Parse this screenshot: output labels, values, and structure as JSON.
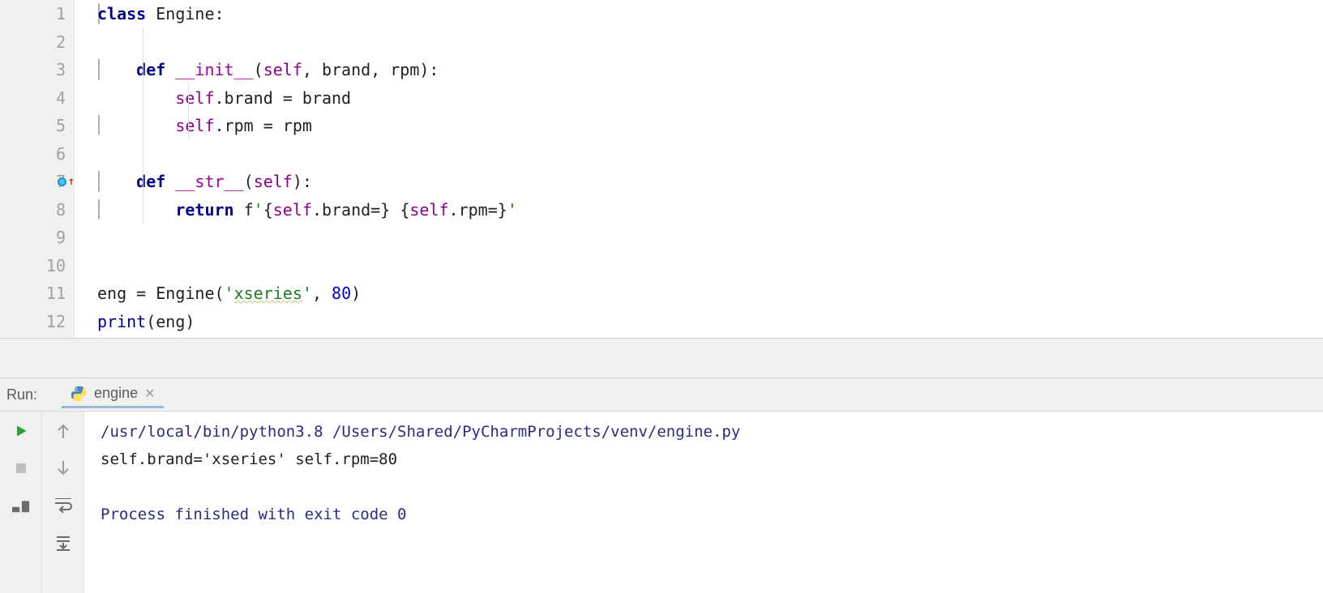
{
  "gutter": {
    "lines": [
      "1",
      "2",
      "3",
      "4",
      "5",
      "6",
      "7",
      "8",
      "9",
      "10",
      "11",
      "12"
    ]
  },
  "code": {
    "l1": {
      "kw": "class",
      "name": " Engine",
      "colon": ":"
    },
    "l3": {
      "kw": "def",
      "name": "__init__",
      "sig_open": "(",
      "self": "self",
      "rest": ", brand, rpm):"
    },
    "l4": {
      "self": "self",
      "rest1": ".brand = brand"
    },
    "l5": {
      "self": "self",
      "rest1": ".rpm = rpm"
    },
    "l7": {
      "kw": "def",
      "name": "__str__",
      "sig_open": "(",
      "self": "self",
      "rest": "):"
    },
    "l8": {
      "kw": "return",
      "fopen": " f",
      "q1": "'",
      "lb1": "{",
      "self1": "self",
      "p1": ".brand=",
      "rb1": "}",
      "sp": " ",
      "lb2": "{",
      "self2": "self",
      "p2": ".rpm=",
      "rb2": "}",
      "q2": "'"
    },
    "l11": {
      "a": "eng = Engine(",
      "q1": "'",
      "s": "xseries",
      "q2": "'",
      "c": ", ",
      "n": "80",
      "e": ")"
    },
    "l12": {
      "p": "print",
      "rest": "(eng)"
    }
  },
  "run": {
    "label": "Run:",
    "tab": "engine",
    "cmd": "/usr/local/bin/python3.8 /Users/Shared/PyCharmProjects/venv/engine.py",
    "out": "self.brand='xseries' self.rpm=80",
    "exit": "Process finished with exit code 0"
  }
}
